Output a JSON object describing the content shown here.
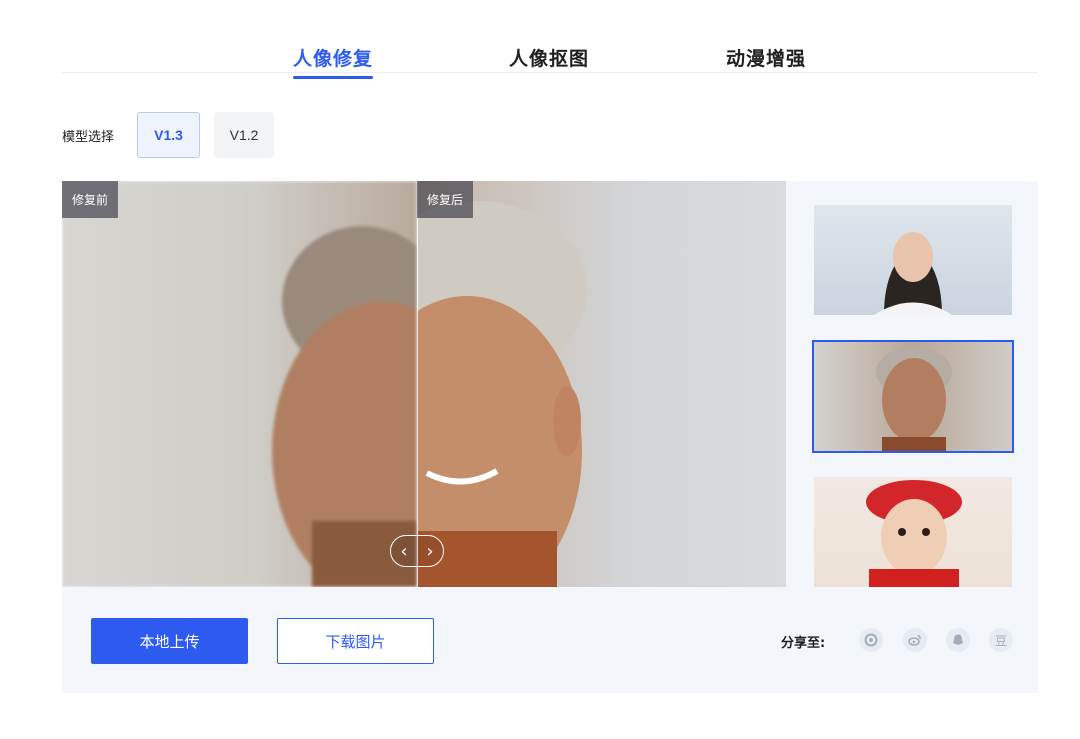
{
  "tabs": [
    {
      "label": "人像修复",
      "active": true
    },
    {
      "label": "人像抠图",
      "active": false
    },
    {
      "label": "动漫增强",
      "active": false
    }
  ],
  "model": {
    "label": "模型选择",
    "versions": [
      {
        "label": "V1.3",
        "active": true
      },
      {
        "label": "V1.2",
        "active": false
      }
    ]
  },
  "compare": {
    "before_label": "修复前",
    "after_label": "修复后",
    "slider_left": "‹",
    "slider_right": "›"
  },
  "thumbnails": [
    {
      "icon": "portrait-young-woman-image",
      "selected": false
    },
    {
      "icon": "portrait-older-man-image",
      "selected": true
    },
    {
      "icon": "portrait-child-red-hat-image",
      "selected": false
    }
  ],
  "actions": {
    "upload_label": "本地上传",
    "download_label": "下载图片"
  },
  "share": {
    "label": "分享至:",
    "icons": [
      "moments-icon",
      "weibo-icon",
      "qq-icon",
      "douban-icon"
    ],
    "douban_glyph": "豆"
  },
  "colors": {
    "accent": "#2d5bf0",
    "panel_bg": "#f3f6fb"
  }
}
